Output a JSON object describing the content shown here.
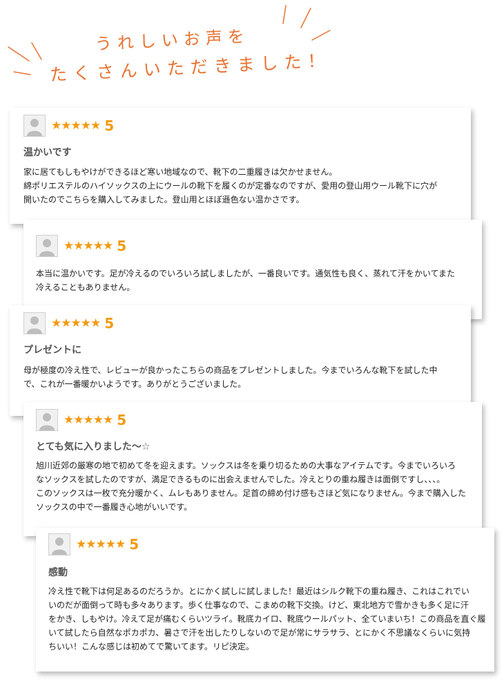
{
  "header": {
    "line1": "うれしいお声を",
    "line2": "たくさんいただきました！"
  },
  "colors": {
    "accent": "#e87332",
    "star": "#f29a12"
  },
  "reviews": [
    {
      "stars": "★★★★★",
      "rating": "5",
      "title": "温かいです",
      "lines": [
        "家に居てもしもやけができるほど寒い地域なので、靴下の二重履きは欠かせません。",
        "綿ポリエステルのハイソックスの上にウールの靴下を履くのが定番なのですが、愛用の登山用ウール靴下に穴が",
        "開いたのでこちらを購入してみました。登山用とほぼ遜色ない温かさです。"
      ]
    },
    {
      "stars": "★★★★★",
      "rating": "5",
      "title": "",
      "lines": [
        "本当に温かいです。足が冷えるのでいろいろ試しましたが、一番良いです。通気性も良く、蒸れて汗をかいてまた",
        "冷えることもありません。"
      ]
    },
    {
      "stars": "★★★★★",
      "rating": "5",
      "title": "プレゼントに",
      "lines": [
        "母が極度の冷え性で、レビューが良かったこちらの商品をプレゼントしました。今までいろんな靴下を試した中",
        "で、これが一番暖かいようです。ありがとうございました。"
      ]
    },
    {
      "stars": "★★★★★",
      "rating": "5",
      "title": "とても気に入りました〜☆",
      "lines": [
        "旭川近郊の厳寒の地で初めて冬を迎えます。ソックスは冬を乗り切るための大事なアイテムです。今までいろいろ",
        "なソックスを試したのですが、満足できるものに出会えませんでした。冷えとりの重ね履きは面倒ですし、、、。",
        "このソックスは一枚で充分暖かく、ムレもありません。足首の締め付け感もさほど気になりません。今まで購入した",
        "ソックスの中で一番履き心地がいいです。"
      ]
    },
    {
      "stars": "★★★★★",
      "rating": "5",
      "title": "感動",
      "lines": [
        "冷え性で靴下は何足あるのだろうか。とにかく試しに試しました！最近はシルク靴下の重ね履き、これはこれでい",
        "いのだが面倒って時も多々あります。歩く仕事なので、こまめの靴下交換。けど、東北地方で雪かきも多く足に汗",
        "をかき、しもやけ。冷えて足が痛むくらいツライ。靴底カイロ、靴底ウールパット、全ていまいち！この商品を直ぐ履",
        "いて試したら自然なポカポカ、暑さで汗を出したりしないので足が常にサラサラ、とにかく不思議なくらいに気持",
        "ちいい！こんな感じは初めてで驚いてます。リピ決定。"
      ]
    }
  ]
}
